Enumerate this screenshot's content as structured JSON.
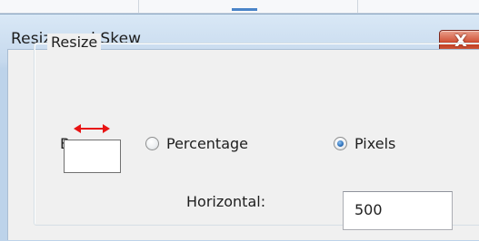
{
  "dialog": {
    "title": "Resize and Skew",
    "close_glyph": "X"
  },
  "resize_group": {
    "legend": "Resize",
    "by_label": "By:",
    "options": [
      {
        "label": "Percentage",
        "selected": false
      },
      {
        "label": "Pixels",
        "selected": true
      }
    ],
    "horizontal_label": "Horizontal:",
    "horizontal_value": "500"
  },
  "icons": {
    "horizontal_resize_arrow": "double-headed-arrow-icon",
    "arrow_color": "#e81313"
  }
}
